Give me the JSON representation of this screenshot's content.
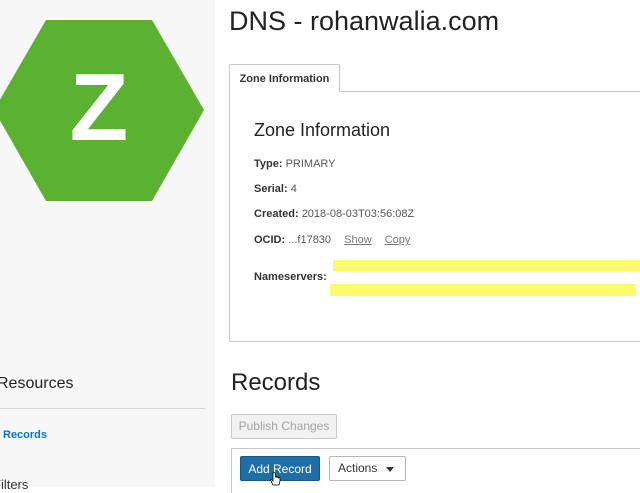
{
  "logo": {
    "letter": "Z",
    "color": "#5bb130"
  },
  "page": {
    "title": "DNS - rohanwalia.com"
  },
  "tabs": [
    {
      "label": "Zone Information"
    }
  ],
  "zone": {
    "heading": "Zone Information",
    "type_label": "Type:",
    "type_value": "PRIMARY",
    "serial_label": "Serial:",
    "serial_value": "4",
    "created_label": "Created:",
    "created_value": "2018-08-03T03:56:08Z",
    "ocid_label": "OCID:",
    "ocid_value": "...f17830",
    "show_link": "Show",
    "copy_link": "Copy",
    "nameservers_label": "Nameservers:"
  },
  "sidebar": {
    "resources_title": "Resources",
    "records_item": "Records",
    "filters_item": "Filters"
  },
  "records": {
    "title": "Records",
    "publish_button": "Publish Changes",
    "add_button": "Add Record",
    "actions_button": "Actions"
  },
  "colors": {
    "accent": "#0572ce",
    "primary_button": "#1e6ea8",
    "highlight": "#fbfb6c"
  }
}
